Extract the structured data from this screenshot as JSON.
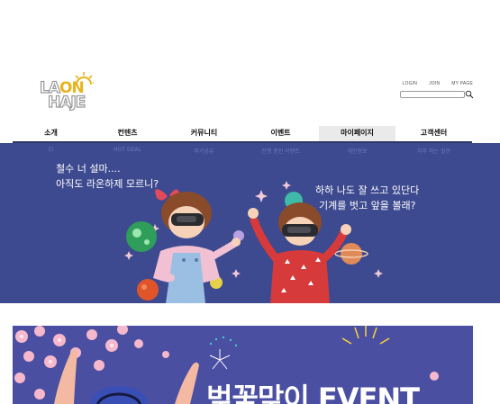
{
  "logo": {
    "line1_grey": "LA",
    "line1_gold": "ON",
    "line2_grey": "HAJE"
  },
  "util_links": [
    "LOGIN",
    "JOIN",
    "MY PAGE"
  ],
  "search": {
    "placeholder": ""
  },
  "nav": {
    "items": [
      {
        "label": "소개"
      },
      {
        "label": "컨텐츠"
      },
      {
        "label": "커뮤니티"
      },
      {
        "label": "이벤트"
      },
      {
        "label": "마이페이지"
      },
      {
        "label": "고객센터"
      }
    ],
    "active_index": 4
  },
  "sub_menu": [
    "CI",
    "HOT DEAL",
    "후기공유",
    "진행 중인 이벤트",
    "개인정보",
    "자주 하는 질문"
  ],
  "hero": {
    "left_line1": "철수 너 설마....",
    "left_line2": "아직도 라온하제 모르니?",
    "right_line1": "하하 나도 잘 쓰고 있단다",
    "right_line2": "기계를 벗고 앞을 볼래?"
  },
  "event": {
    "title": "벚꽃맞이 EVENT"
  },
  "colors": {
    "nav_underline": "#2c3668",
    "hero_bg": "#3d4a8f",
    "event_bg": "#4b4fa2",
    "logo_gold": "#e8b41d"
  }
}
